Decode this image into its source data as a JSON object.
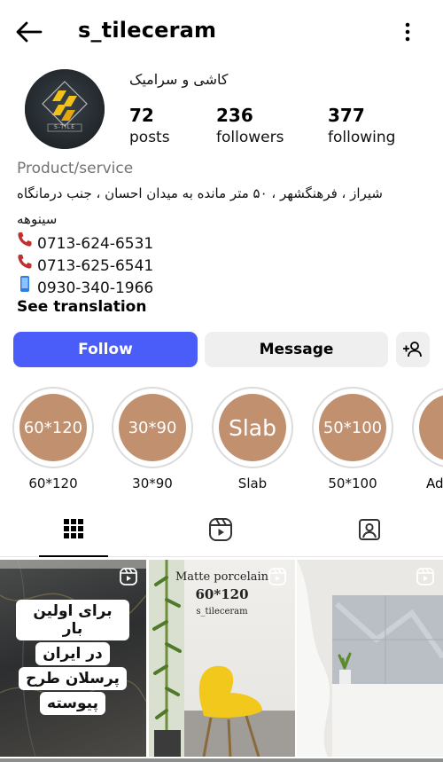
{
  "header": {
    "username": "s_tileceram",
    "back_icon": "arrow-left-icon",
    "more_icon": "more-vertical-icon"
  },
  "profile": {
    "display_name": "کاشی و سرامیک",
    "avatar_text": "S-TILE",
    "stats": [
      {
        "value": "72",
        "label": "posts"
      },
      {
        "value": "236",
        "label": "followers"
      },
      {
        "value": "377",
        "label": "following"
      }
    ],
    "category": "Product/service",
    "address_line1": "شیراز ، فرهنگشهر ، ۵۰ متر مانده به میدان احسان ، جنب درمانگاه",
    "address_line2": "سینوهه",
    "phones": [
      {
        "icon": "telephone-icon",
        "number": "0713-624-6531"
      },
      {
        "icon": "telephone-icon",
        "number": "0713-625-6541"
      },
      {
        "icon": "mobile-phone-icon",
        "number": "0930-340-1966"
      }
    ],
    "see_translation": "See translation"
  },
  "actions": {
    "follow": "Follow",
    "message": "Message",
    "suggest_icon": "add-person-icon"
  },
  "highlights": [
    {
      "cover": "60*120",
      "label": "60*120"
    },
    {
      "cover": "30*90",
      "label": "30*90"
    },
    {
      "cover": "Slab",
      "label": "Slab"
    },
    {
      "cover": "50*100",
      "label": "50*100"
    },
    {
      "cover": "A",
      "label": "Ad"
    }
  ],
  "tabs": [
    {
      "icon": "grid-icon",
      "active": true
    },
    {
      "icon": "reels-icon",
      "active": false
    },
    {
      "icon": "tagged-icon",
      "active": false
    }
  ],
  "posts": [
    {
      "lines": [
        "برای اولین بار",
        "در ایران",
        "پرسلان طرح",
        "پیوسته"
      ]
    },
    {
      "title": "Matte porcelain",
      "size": "60*120",
      "handle": "s_tileceram"
    },
    {}
  ],
  "colors": {
    "follow_blue": "#4a5df9",
    "highlight_tan": "#c0906f",
    "secondary_gray": "#efefef"
  }
}
